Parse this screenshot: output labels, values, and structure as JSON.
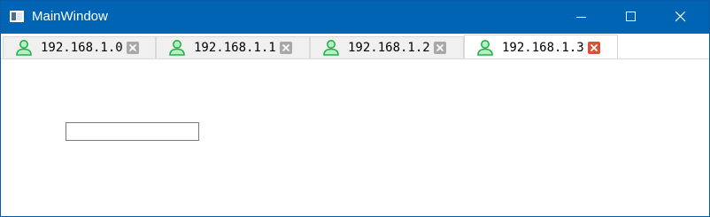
{
  "window": {
    "title": "MainWindow",
    "colors": {
      "titlebar": "#0064b4",
      "tab_icon": "#2ecc71",
      "active_close": "#d2553a"
    }
  },
  "tabs": [
    {
      "label": "192.168.1.0",
      "icon": "user-icon",
      "active": false
    },
    {
      "label": "192.168.1.1",
      "icon": "user-icon",
      "active": false
    },
    {
      "label": "192.168.1.2",
      "icon": "user-icon",
      "active": false
    },
    {
      "label": "192.168.1.3",
      "icon": "user-icon",
      "active": true
    }
  ],
  "content": {
    "input_value": ""
  }
}
